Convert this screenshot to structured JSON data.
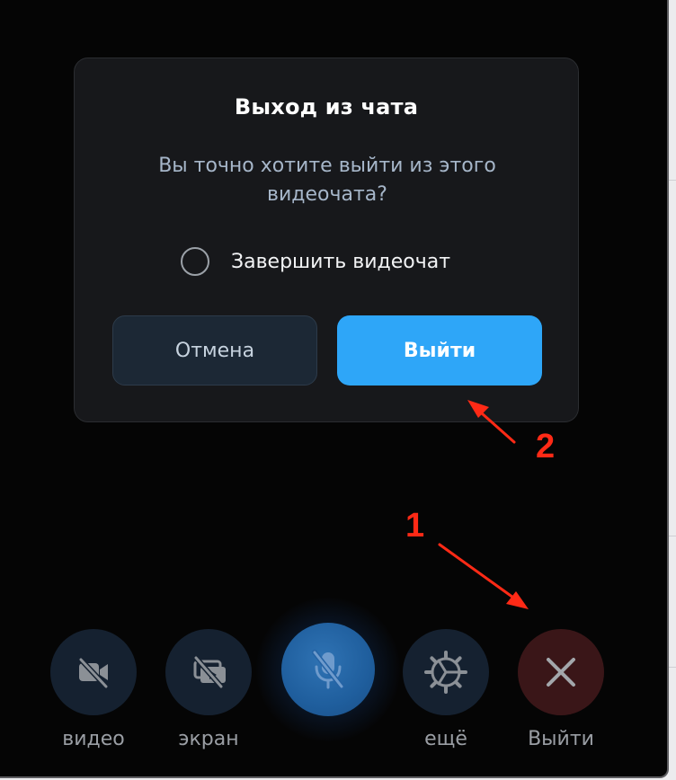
{
  "dialog": {
    "title": "Выход из чата",
    "message": "Вы точно хотите выйти из этого видеочата?",
    "option_label": "Завершить видеочат",
    "option_checked": false,
    "cancel_label": "Отмена",
    "confirm_label": "Выйти"
  },
  "toolbar": {
    "video_label": "видео",
    "screen_label": "экран",
    "more_label": "ещё",
    "leave_label": "Выйти"
  },
  "annotations": {
    "marker_1": "1",
    "marker_2": "2"
  },
  "colors": {
    "accent": "#2ea6f8",
    "annotation": "#ff2a16",
    "leave_button": "#3a1618",
    "dialog_bg": "#17181b"
  }
}
